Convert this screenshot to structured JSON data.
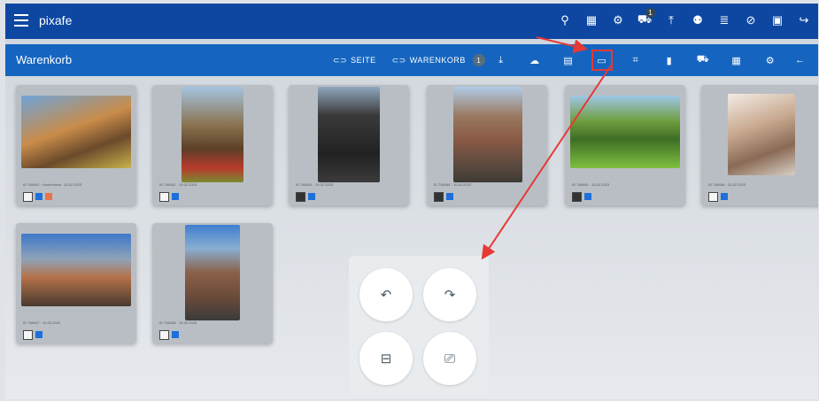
{
  "header": {
    "app_title": "pixafe",
    "icons": [
      "search-icon",
      "grid-icon",
      "gear-icon",
      "cart-icon",
      "upload-icon",
      "users-icon",
      "database-icon",
      "check-circle-icon",
      "book-icon",
      "logout-icon"
    ],
    "cart_badge": "1"
  },
  "toolbar": {
    "title": "Warenkorb",
    "page_label": "SEITE",
    "cart_label": "WARENKORB",
    "cart_count": "1"
  },
  "images": [
    {
      "caption": "ID 748441 · Hochformat · 10.02.2023",
      "checked": false,
      "tags": [
        "#1e6fd9",
        "#e8734a"
      ]
    },
    {
      "caption": "ID 748442 · 10.02.2023",
      "checked": false,
      "tags": [
        "#1e6fd9"
      ]
    },
    {
      "caption": "ID 748443 · 10.02.2023",
      "checked": true,
      "tags": [
        "#1e6fd9"
      ]
    },
    {
      "caption": "ID 748444 · 10.02.2023",
      "checked": true,
      "tags": [
        "#1e6fd9"
      ]
    },
    {
      "caption": "ID 748445 · 10.02.2023",
      "checked": true,
      "tags": [
        "#1e6fd9"
      ]
    },
    {
      "caption": "ID 748446 · 10.02.2023",
      "checked": false,
      "tags": [
        "#1e6fd9"
      ]
    },
    {
      "caption": "ID 748447 · 10.02.2023",
      "checked": false,
      "tags": [
        "#1e6fd9"
      ]
    },
    {
      "caption": "ID 748448 · 10.02.2023",
      "checked": false,
      "tags": [
        "#1e6fd9"
      ]
    }
  ],
  "popup": {
    "icons": [
      "rotate-left-icon",
      "rotate-right-icon",
      "frame-icon",
      "monitor-settings-icon"
    ]
  },
  "colors": {
    "header": "#0d47a1",
    "toolbar": "#1565c0",
    "annotation": "#e53935"
  }
}
